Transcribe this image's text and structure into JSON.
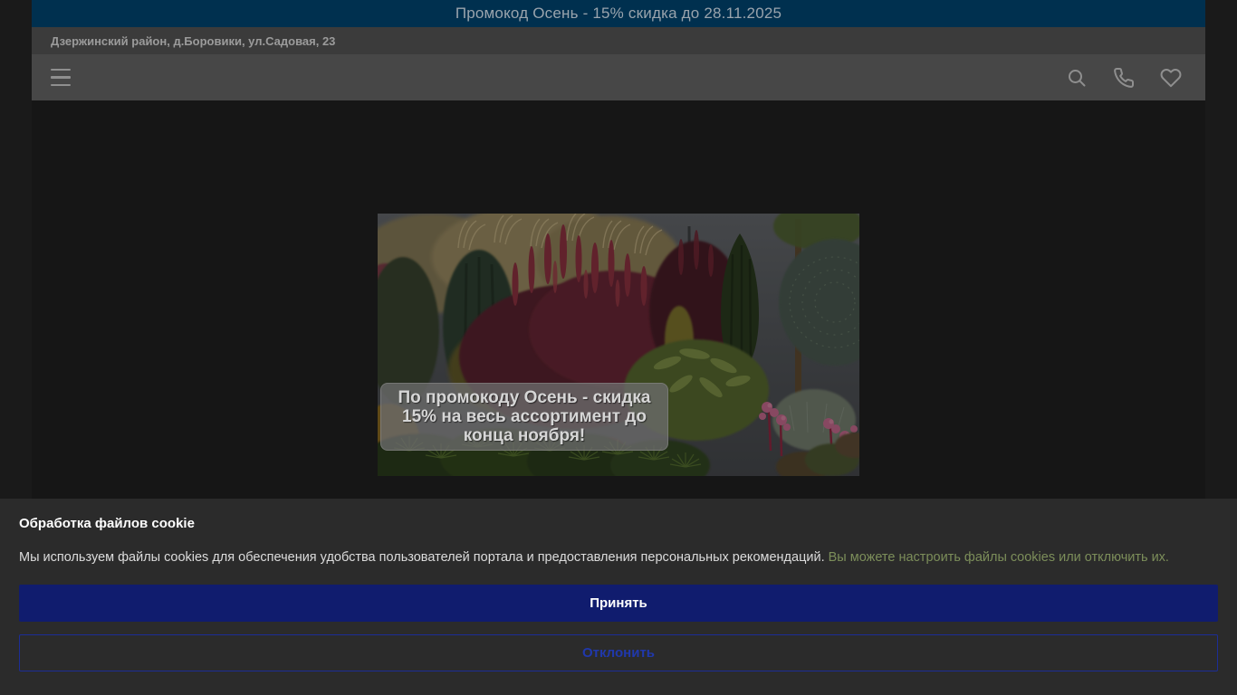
{
  "promo_bar": {
    "text": "Промокод Осень - 15% скидка до 28.11.2025"
  },
  "address_bar": {
    "text": "Дзержинский район, д.Боровики, ул.Садовая, 23"
  },
  "header": {
    "icons": [
      "hamburger-icon",
      "search-icon",
      "phone-icon",
      "heart-icon"
    ]
  },
  "hero": {
    "overlay_text": "По промокоду Осень - скидка 15% на весь ассортимент до конца ноября!"
  },
  "cookie_banner": {
    "title": "Обработка файлов cookie",
    "message": "Мы используем файлы cookies для обеспечения удобства пользователей портала и предоставления персональных рекомендаций. ",
    "settings_link": "Вы можете настроить файлы cookies или отключить их.",
    "accept_label": "Принять",
    "decline_label": "Отклонить"
  },
  "colors": {
    "promo_bar_bg": "#00304f",
    "promo_bar_text": "#9aa4ad",
    "address_bar_bg": "#3b3b3b",
    "header_bg": "#474747",
    "icon": "#8f8f8f",
    "page_bg": "#1a1a1a",
    "content_bg": "#161616",
    "banner_bg": "#2b2b2b",
    "banner_text": "#dcdcdc",
    "link": "#7c8e5a",
    "accept_bg": "#101c6e",
    "accept_text": "#ffffff",
    "decline_border": "#1c2d96",
    "decline_text": "#2038ac",
    "overlay_text": "#d6d6d6"
  }
}
